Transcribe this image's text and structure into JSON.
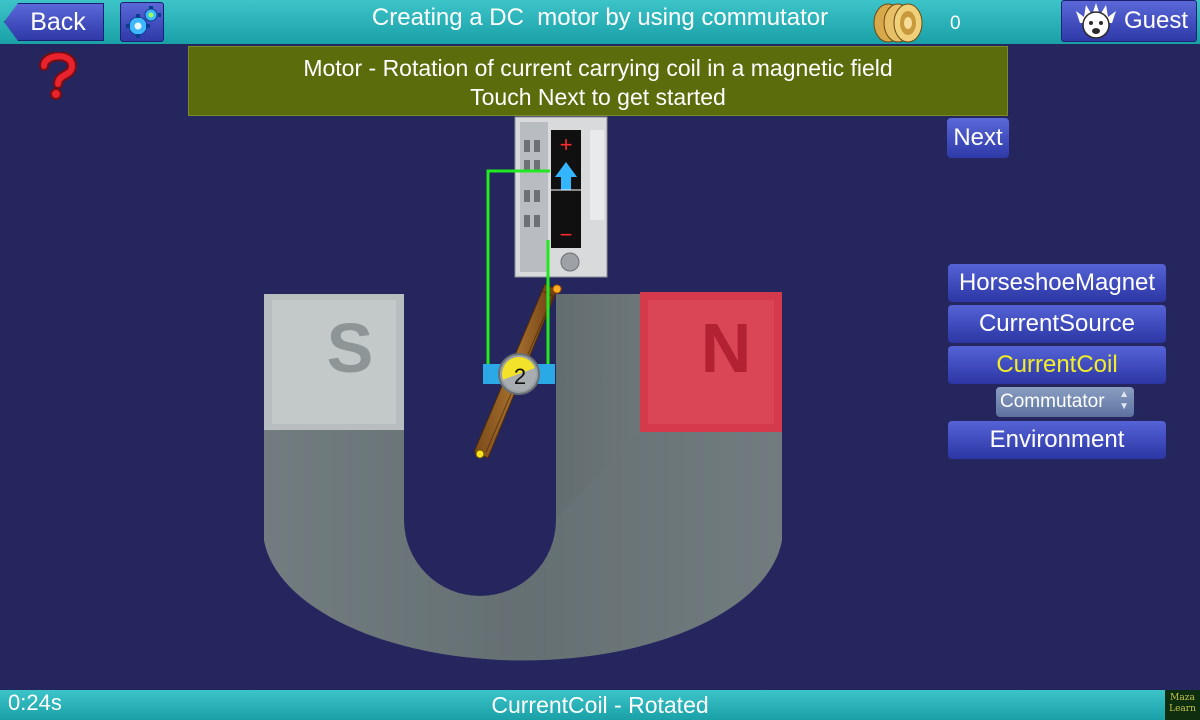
{
  "header": {
    "back_label": "Back",
    "title": "Creating a DC  motor by using commutator",
    "score": "0",
    "user_label": "Guest"
  },
  "banner": {
    "line1": "Motor - Rotation of current carrying coil in a magnetic field",
    "line2": "Touch Next to get started"
  },
  "next_label": "Next",
  "panel": {
    "items": [
      {
        "label": "HorseshoeMagnet",
        "active": false
      },
      {
        "label": "CurrentSource",
        "active": false
      },
      {
        "label": "CurrentCoil",
        "active": true
      },
      {
        "label": "Environment",
        "active": false
      }
    ],
    "commutator_select": "Commutator"
  },
  "scene": {
    "magnet_left_pole": "S",
    "magnet_right_pole": "N",
    "source_plus": "+",
    "source_minus": "−",
    "commutator_number": "2"
  },
  "footer": {
    "timer": "0:24s",
    "status": "CurrentCoil - Rotated",
    "logo_line1": "Maza",
    "logo_line2": "Learn"
  },
  "colors": {
    "background": "#26265e",
    "bar": "#2ab3b9",
    "banner": "#5b6c0c",
    "button": "#3e4bc2",
    "active_text": "#f3ee2a",
    "wire": "#1ee61e",
    "magnet_red": "#d63a4a",
    "magnet_grey": "#6e7a7e"
  }
}
